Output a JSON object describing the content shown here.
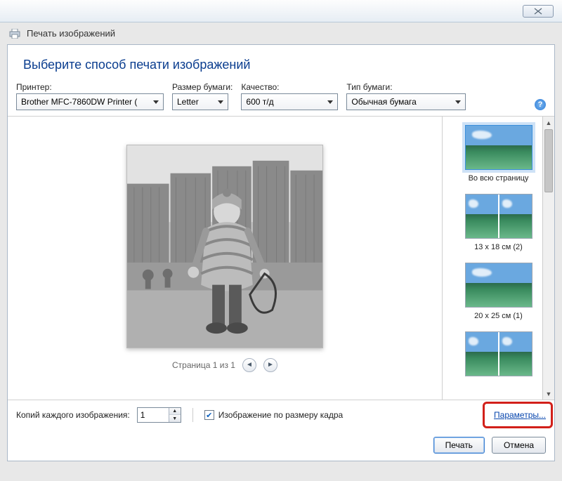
{
  "window": {
    "title": "Печать изображений"
  },
  "heading": "Выберите способ печати изображений",
  "controls": {
    "printer_label": "Принтер:",
    "printer_value": "Brother MFC-7860DW Printer ( ",
    "papersize_label": "Размер бумаги:",
    "papersize_value": "Letter",
    "quality_label": "Качество:",
    "quality_value": "600 т/д",
    "papertype_label": "Тип бумаги:",
    "papertype_value": "Обычная бумага"
  },
  "preview": {
    "page_label": "Страница 1 из 1"
  },
  "layouts": [
    {
      "label": "Во всю страницу"
    },
    {
      "label": "13 x 18 см (2)"
    },
    {
      "label": "20 x 25 см (1)"
    },
    {
      "label": ""
    }
  ],
  "copies": {
    "label": "Копий каждого изображения:",
    "value": "1",
    "fit_label": "Изображение по размеру кадра",
    "fit_checked": true,
    "options_link": "Параметры..."
  },
  "footer": {
    "print": "Печать",
    "cancel": "Отмена"
  }
}
